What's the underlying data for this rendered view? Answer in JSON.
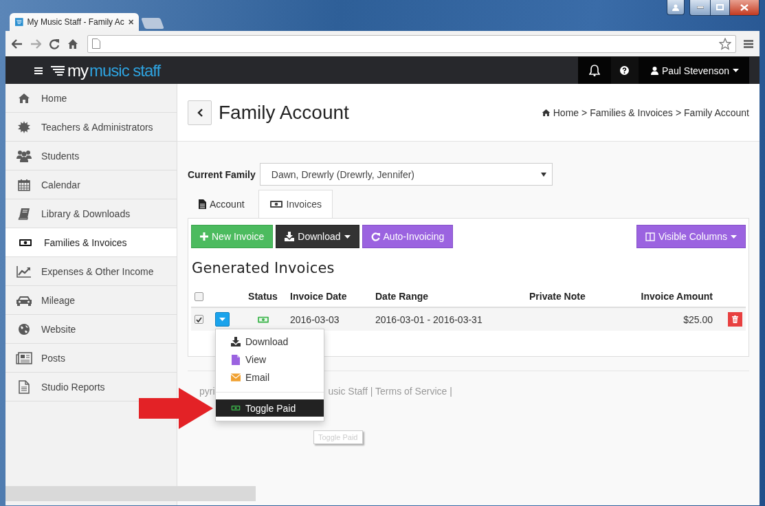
{
  "browser": {
    "tab_title": "My Music Staff - Family Ac"
  },
  "topbar": {
    "logo_first": "my",
    "logo_second": "music staff",
    "user": "Paul Stevenson"
  },
  "sidebar": {
    "items": [
      {
        "label": "Home",
        "selected": false
      },
      {
        "label": "Teachers & Administrators",
        "selected": false
      },
      {
        "label": "Students",
        "selected": false
      },
      {
        "label": "Calendar",
        "selected": false
      },
      {
        "label": "Library & Downloads",
        "selected": false
      },
      {
        "label": "Families & Invoices",
        "selected": true
      },
      {
        "label": "Expenses & Other Income",
        "selected": false
      },
      {
        "label": "Mileage",
        "selected": false
      },
      {
        "label": "Website",
        "selected": false
      },
      {
        "label": "Posts",
        "selected": false
      },
      {
        "label": "Studio Reports",
        "selected": false
      }
    ]
  },
  "page": {
    "title": "Family Account",
    "breadcrumb": [
      "Home",
      "Families & Invoices",
      "Family Account"
    ],
    "breadcrumb_separator": ">"
  },
  "current_family": {
    "label": "Current Family",
    "value": "Dawn, Drewrly (Drewrly, Jennifer)"
  },
  "tabs": [
    {
      "label": "Account",
      "selected": false
    },
    {
      "label": "Invoices",
      "selected": true
    }
  ],
  "toolbar": [
    {
      "label": "New Invoice",
      "kind": "create"
    },
    {
      "label": "Download",
      "kind": "download"
    },
    {
      "label": "Auto-Invoicing",
      "kind": "auto"
    },
    {
      "label": "Visible Columns",
      "kind": "columns"
    }
  ],
  "section_title": "Generated Invoices",
  "table": {
    "select_all_checked": false,
    "columns": [
      "Status",
      "Invoice Date",
      "Date Range",
      "Private Note",
      "Invoice Amount"
    ],
    "rows": [
      {
        "checked": true,
        "paid": true,
        "invoice_date": "2016-03-03",
        "date_range": "2016-03-01 - 2016-03-31",
        "amount": "$25.00"
      }
    ]
  },
  "row_menu": {
    "items": [
      {
        "label": "Download",
        "selected": false
      },
      {
        "label": "View",
        "selected": false
      },
      {
        "label": "Email",
        "selected": false
      },
      {
        "label": "Toggle Paid",
        "selected": true
      }
    ]
  },
  "footer": {
    "left": "pyri",
    "right": "usic Staff | Terms of Service |"
  },
  "tooltip": "Toggle Paid"
}
